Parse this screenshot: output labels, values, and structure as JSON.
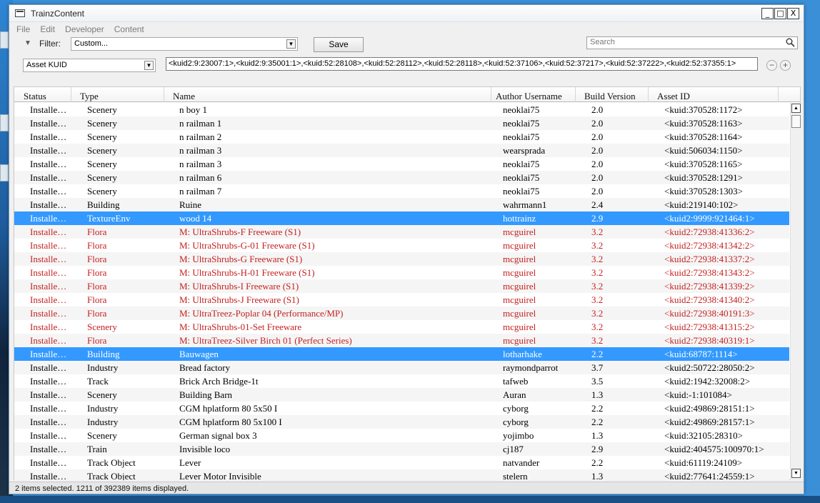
{
  "window": {
    "title": "TrainzContent",
    "minimize": "_",
    "maximize": "□",
    "close": "X"
  },
  "menu": [
    "File",
    "Edit",
    "Developer",
    "Content"
  ],
  "toolbar": {
    "filter_label": "Filter:",
    "filter_value": "Custom...",
    "save_label": "Save",
    "search_placeholder": "Search",
    "field_select_value": "Asset KUID",
    "kuid_list": "<kuid2:9:23007:1>,<kuid2:9:35001:1>,<kuid:52:28108>,<kuid:52:28112>,<kuid:52:28118>,<kuid:52:37106>,<kuid:52:37217>,<kuid:52:37222>,<kuid2:52:37355:1>",
    "remove_label": "−",
    "add_label": "+"
  },
  "columns": [
    "Status",
    "Type",
    "Name",
    "Author Username",
    "Build Version",
    "Asset ID"
  ],
  "rows": [
    {
      "status": "Installe…",
      "type": "Scenery",
      "name": "n boy 1",
      "author": "neoklai75",
      "build": "2.0",
      "id": "<kuid:370528:1172>",
      "style": ""
    },
    {
      "status": "Installe…",
      "type": "Scenery",
      "name": "n railman 1",
      "author": "neoklai75",
      "build": "2.0",
      "id": "<kuid:370528:1163>",
      "style": ""
    },
    {
      "status": "Installe…",
      "type": "Scenery",
      "name": "n railman 2",
      "author": "neoklai75",
      "build": "2.0",
      "id": "<kuid:370528:1164>",
      "style": ""
    },
    {
      "status": "Installe…",
      "type": "Scenery",
      "name": "n railman 3",
      "author": "wearsprada",
      "build": "2.0",
      "id": "<kuid:506034:1150>",
      "style": ""
    },
    {
      "status": "Installe…",
      "type": "Scenery",
      "name": "n railman 3",
      "author": "neoklai75",
      "build": "2.0",
      "id": "<kuid:370528:1165>",
      "style": ""
    },
    {
      "status": "Installe…",
      "type": "Scenery",
      "name": "n railman 6",
      "author": "neoklai75",
      "build": "2.0",
      "id": "<kuid:370528:1291>",
      "style": ""
    },
    {
      "status": "Installe…",
      "type": "Scenery",
      "name": "n railman 7",
      "author": "neoklai75",
      "build": "2.0",
      "id": "<kuid:370528:1303>",
      "style": ""
    },
    {
      "status": "Installe…",
      "type": "Building",
      "name": "Ruine",
      "author": "wahrmann1",
      "build": "2.4",
      "id": "<kuid:219140:102>",
      "style": ""
    },
    {
      "status": "Installe…",
      "type": "TextureEnv",
      "name": "wood 14",
      "author": "hottrainz",
      "build": "2.9",
      "id": "<kuid2:9999:921464:1>",
      "style": "sel"
    },
    {
      "status": "Installe…",
      "type": "Flora",
      "name": "M: UltraShrubs-F Freeware (S1)",
      "author": "mcguirel",
      "build": "3.2",
      "id": "<kuid2:72938:41336:2>",
      "style": "red"
    },
    {
      "status": "Installe…",
      "type": "Flora",
      "name": "M: UltraShrubs-G-01 Freeware (S1)",
      "author": "mcguirel",
      "build": "3.2",
      "id": "<kuid2:72938:41342:2>",
      "style": "red"
    },
    {
      "status": "Installe…",
      "type": "Flora",
      "name": "M: UltraShrubs-G Freeware (S1)",
      "author": "mcguirel",
      "build": "3.2",
      "id": "<kuid2:72938:41337:2>",
      "style": "red"
    },
    {
      "status": "Installe…",
      "type": "Flora",
      "name": "M: UltraShrubs-H-01 Freeware (S1)",
      "author": "mcguirel",
      "build": "3.2",
      "id": "<kuid2:72938:41343:2>",
      "style": "red"
    },
    {
      "status": "Installe…",
      "type": "Flora",
      "name": "M: UltraShrubs-I Freeware (S1)",
      "author": "mcguirel",
      "build": "3.2",
      "id": "<kuid2:72938:41339:2>",
      "style": "red"
    },
    {
      "status": "Installe…",
      "type": "Flora",
      "name": "M: UltraShrubs-J Freeware (S1)",
      "author": "mcguirel",
      "build": "3.2",
      "id": "<kuid2:72938:41340:2>",
      "style": "red"
    },
    {
      "status": "Installe…",
      "type": "Flora",
      "name": "M: UltraTreez-Poplar 04 (Performance/MP)",
      "author": "mcguirel",
      "build": "3.2",
      "id": "<kuid2:72938:40191:3>",
      "style": "red"
    },
    {
      "status": "Installe…",
      "type": "Scenery",
      "name": "M: UltraShrubs-01-Set Freeware",
      "author": "mcguirel",
      "build": "3.2",
      "id": "<kuid2:72938:41315:2>",
      "style": "red"
    },
    {
      "status": "Installe…",
      "type": "Flora",
      "name": "M: UltraTreez-Silver Birch 01 (Perfect Series)",
      "author": "mcguirel",
      "build": "3.2",
      "id": "<kuid2:72938:40319:1>",
      "style": "red"
    },
    {
      "status": "Installe…",
      "type": "Building",
      "name": "Bauwagen",
      "author": "lotharhake",
      "build": "2.2",
      "id": "<kuid:68787:1114>",
      "style": "sel"
    },
    {
      "status": "Installe…",
      "type": "Industry",
      "name": "Bread factory",
      "author": "raymondparrot",
      "build": "3.7",
      "id": "<kuid2:50722:28050:2>",
      "style": ""
    },
    {
      "status": "Installe…",
      "type": "Track",
      "name": "Brick Arch Bridge-1t",
      "author": "tafweb",
      "build": "3.5",
      "id": "<kuid2:1942:32008:2>",
      "style": ""
    },
    {
      "status": "Installe…",
      "type": "Scenery",
      "name": "Building Barn",
      "author": "Auran",
      "build": "1.3",
      "id": "<kuid:-1:101084>",
      "style": ""
    },
    {
      "status": "Installe…",
      "type": "Industry",
      "name": "CGM hplatform 80 5x50 I",
      "author": "cyborg",
      "build": "2.2",
      "id": "<kuid2:49869:28151:1>",
      "style": ""
    },
    {
      "status": "Installe…",
      "type": "Industry",
      "name": "CGM hplatform 80 5x100 I",
      "author": "cyborg",
      "build": "2.2",
      "id": "<kuid2:49869:28157:1>",
      "style": ""
    },
    {
      "status": "Installe…",
      "type": "Scenery",
      "name": "German signal box 3",
      "author": "yojimbo",
      "build": "1.3",
      "id": "<kuid:32105:28310>",
      "style": ""
    },
    {
      "status": "Installe…",
      "type": "Train",
      "name": "Invisible loco",
      "author": "cj187",
      "build": "2.9",
      "id": "<kuid2:404575:100970:1>",
      "style": ""
    },
    {
      "status": "Installe…",
      "type": "Track Object",
      "name": "Lever",
      "author": "natvander",
      "build": "2.2",
      "id": "<kuid:61119:24109>",
      "style": ""
    },
    {
      "status": "Installe…",
      "type": "Track Object",
      "name": "Lever Motor Invisible",
      "author": "stelern",
      "build": "1.3",
      "id": "<kuid2:77641:24559:1>",
      "style": ""
    }
  ],
  "status_bar": "2 items selected.  1211 of 392389 items displayed.",
  "colors": {
    "selected_row": "#3399ff",
    "faulty_row_text": "#c42020",
    "desktop": "#3a8fd6"
  }
}
